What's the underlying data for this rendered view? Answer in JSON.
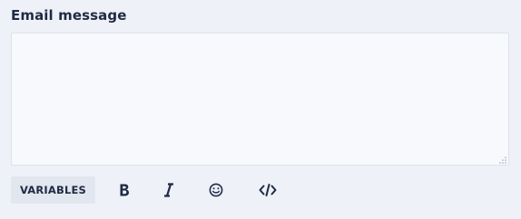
{
  "form": {
    "label": "Email message",
    "value": "",
    "placeholder": ""
  },
  "toolbar": {
    "variables_label": "VARIABLES",
    "icons": [
      "bold-icon",
      "italic-icon",
      "emoji-icon",
      "code-icon"
    ]
  },
  "colors": {
    "background": "#eef1f8",
    "textarea_bg": "#f8f9fc",
    "textarea_border": "#dde2ec",
    "button_bg": "#e1e6ef",
    "text": "#1f2a44"
  }
}
